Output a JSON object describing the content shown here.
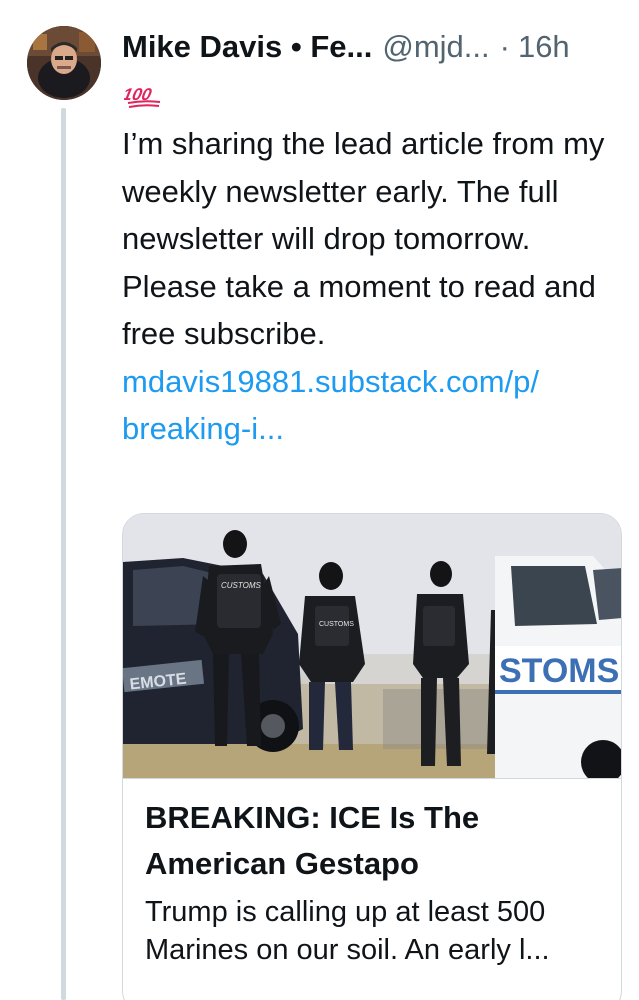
{
  "author": {
    "display_name": "Mike Davis • Fe...",
    "handle": "@mjd...",
    "separator": "·",
    "time": "16h"
  },
  "emoji": {
    "name": "hundred-points-icon",
    "text": "100",
    "color": "#e0245e"
  },
  "body": {
    "text": "I’m sharing the lead article from my weekly newsletter early. The full newsletter will drop tomorrow. Please take a moment to read and free subscribe.",
    "link_line1": "mdavis19881.substack.com/p/",
    "link_line2": "breaking-i..."
  },
  "card": {
    "image_text_van": "STOMS",
    "image_text_car": "EMOTE",
    "image_text_vest_1": "CUSTOMS",
    "image_text_vest_2": "CUSTOMS",
    "title": "BREAKING: ICE Is The American Gestapo",
    "description_line1": "Trump is calling up at least 500",
    "description_line2": "Marines on our soil. An early l..."
  },
  "colors": {
    "link": "#1d9bf0",
    "secondary_text": "#536471",
    "border": "#cfd9de",
    "thread_line": "#cfd9de"
  }
}
